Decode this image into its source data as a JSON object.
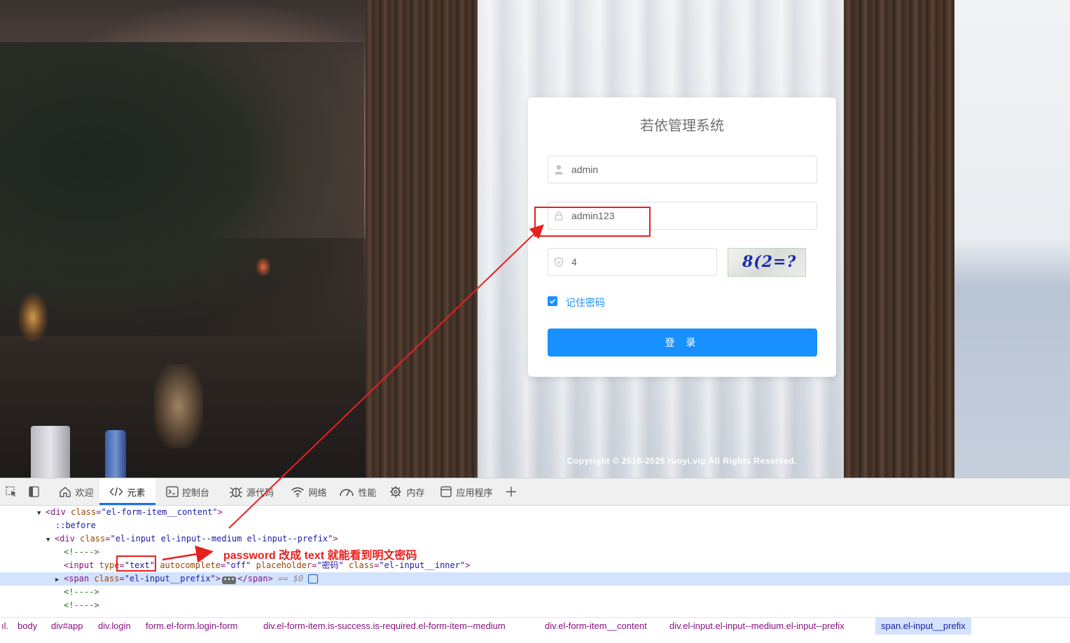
{
  "login": {
    "title": "若依管理系统",
    "username_value": "admin",
    "password_value": "admin123",
    "code_value": "4",
    "captcha_text": "8(2=?",
    "remember_label": "记住密码",
    "remember_checked": true,
    "login_button": "登 录",
    "accent_color": "#1890ff"
  },
  "footer": {
    "copyright": "Copyright © 2018-2025 ruoyi.vip All Rights Reserved."
  },
  "devtools": {
    "tabs": [
      {
        "label": "欢迎",
        "icon": "home-icon"
      },
      {
        "label": "元素",
        "icon": "code-icon",
        "active": true
      },
      {
        "label": "控制台",
        "icon": "console-icon"
      },
      {
        "label": "源代码",
        "icon": "bug-icon"
      },
      {
        "label": "网络",
        "icon": "wifi-icon"
      },
      {
        "label": "性能",
        "icon": "gauge-icon"
      },
      {
        "label": "内存",
        "icon": "memory-icon"
      },
      {
        "label": "应用程序",
        "icon": "app-icon"
      }
    ],
    "code": {
      "l1_tag_open": "<div ",
      "l1_attr": "class",
      "l1_val": "\"el-form-item__content\"",
      "l2": "::before",
      "l3_tag_open": "<div ",
      "l3_attr": "class",
      "l3_val": "\"el-input el-input--medium el-input--prefix\"",
      "comment": "<!---->",
      "l5_tag_open": "<input ",
      "l5_attr1": "type",
      "l5_val1": "\"text\"",
      "l5_attr2": "autocomplete",
      "l5_val2": "\"off\"",
      "l5_attr3": "placeholder",
      "l5_val3": "\"密码\"",
      "l5_attr4": "class",
      "l5_val4": "\"el-input__inner\"",
      "l6_tag_open": "<span ",
      "l6_attr": "class",
      "l6_val": "\"el-input__prefix\"",
      "l6_close": "</span>",
      "l6_ref": "== $0"
    },
    "breadcrumb": [
      "ıl.",
      "body",
      "div#app",
      "div.login",
      "form.el-form.login-form",
      "div.el-form-item.is-success.is-required.el-form-item--medium",
      "div.el-form-item__content",
      "div.el-input.el-input--medium.el-input--prefix",
      "span.el-input__prefix"
    ]
  },
  "annotation": {
    "text": "password 改成 text 就能看到明文密码",
    "color": "#e8201f"
  }
}
